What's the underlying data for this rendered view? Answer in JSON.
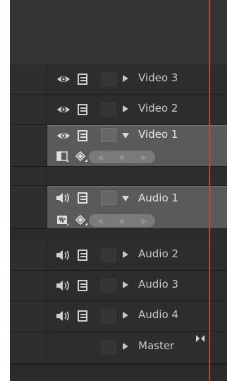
{
  "tracks": [
    {
      "label": "Video 3",
      "kind": "video",
      "expanded": false,
      "eye_icon": "eye-icon",
      "sync_icon": "sync-lock-icon"
    },
    {
      "label": "Video 2",
      "kind": "video",
      "expanded": false,
      "eye_icon": "eye-icon",
      "sync_icon": "sync-lock-icon"
    },
    {
      "label": "Video 1",
      "kind": "video",
      "expanded": true,
      "eye_icon": "eye-icon",
      "sync_icon": "sync-lock-icon"
    },
    {
      "label": "Audio 1",
      "kind": "audio",
      "expanded": true,
      "eye_icon": "speaker-icon",
      "sync_icon": "sync-lock-icon"
    },
    {
      "label": "Audio 2",
      "kind": "audio",
      "expanded": false,
      "eye_icon": "speaker-icon",
      "sync_icon": "sync-lock-icon"
    },
    {
      "label": "Audio 3",
      "kind": "audio",
      "expanded": false,
      "eye_icon": "speaker-icon",
      "sync_icon": "sync-lock-icon"
    },
    {
      "label": "Audio 4",
      "kind": "audio",
      "expanded": false,
      "eye_icon": "speaker-icon",
      "sync_icon": "sync-lock-icon"
    }
  ],
  "master": {
    "label": "Master"
  },
  "colors": {
    "playhead": "#d4401c"
  }
}
